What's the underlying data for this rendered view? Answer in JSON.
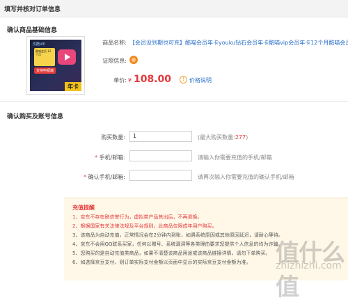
{
  "header": {
    "title": "填写并核对订单信息"
  },
  "product_section": {
    "title": "确认商品基础信息",
    "thumb": {
      "brand": "优酷VIP",
      "box_text": "酷喵会员 12个月",
      "tag": "支持电视端",
      "corner": "年卡"
    },
    "name_label": "商品名称:",
    "name_value": "【会员没到期也可充】酷喵会员年卡youku钻石会员年卡酷喵vip会员年卡12个月酷喵会员年",
    "cert_label": "证照信息:",
    "price_label": "单价:",
    "price_currency": "¥",
    "price_value": "108.00",
    "price_info_link": "价格说明"
  },
  "account_section": {
    "title": "确认购买及账号信息",
    "qty_label": "购买数量:",
    "qty_value": "1",
    "qty_hint_prefix": "(最大购买数量:",
    "qty_max": "277",
    "qty_hint_suffix": ")",
    "phone_star": "*",
    "phone_label": "手机/邮箱:",
    "phone_placeholder": "",
    "phone_hint": "请输入你需要充值的手机/邮箱",
    "confirm_star": "*",
    "confirm_label": "确认手机/邮箱:",
    "confirm_placeholder": "",
    "confirm_hint": "请再次输入你需要充值的确认手机/邮箱"
  },
  "notice": {
    "title": "充值提醒",
    "lines": [
      "1、京东不存在刷信誉行为，虚拟类产品售出后，不再退换。",
      "2、根据国家有关法律法规及平台规则，此商品仅限成年用户购买。",
      "3、该商品为自动充值，正常情况会在2分钟内到账，如遇系统原因或其他原因延迟，请耐心等待。",
      "4、京东不会用QQ联系买家，任何以赠号、系统漏洞等各类理由要求您提供个人信息的均为诈骗。",
      "5、您购买的是自动充值类商品，如果不清楚该商品用途或该商品链接详情，请勿下单购买。",
      "6、如选择京豆支付，则订单实际支付金额以页面中显示的实际京豆支付金额为准。"
    ]
  },
  "watermark": {
    "main": "值什么值",
    "sub": "zhizhizhi.com"
  }
}
